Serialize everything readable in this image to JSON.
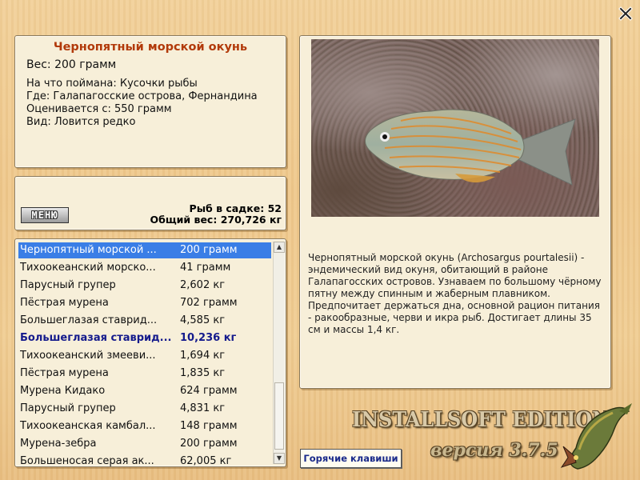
{
  "fish": {
    "name": "Чернопятный морской окунь",
    "weight_line": "Вес: 200 грамм",
    "info_lines": [
      "На что поймана: Кусочки рыбы",
      "Где: Галапагосские острова, Фернандина",
      "Оценивается с: 550 грамм",
      "Вид: Ловится редко"
    ],
    "photo_icon": "fish-photo",
    "description": "Чернопятный морской окунь (Archosargus pourtalesii) - эндемический вид окуня, обитающий в районе Галапагосских островов. Узнаваем по большому чёрному пятну между спинным и жаберным плавником. Предпочитает держаться дна, основной рацион питания - ракообразные, черви и икра рыб. Достигает длины 35 см и массы 1,4 кг."
  },
  "stats": {
    "menu_label": "МЕНЮ",
    "fish_count": "Рыб в садке: 52",
    "total_weight": "Общий вес: 270,726 кг"
  },
  "catch_list": [
    {
      "name": "Чернопятный морской ...",
      "weight": "200 грамм",
      "selected": true
    },
    {
      "name": "Тихоокеанский морско...",
      "weight": "41 грамм"
    },
    {
      "name": "Парусный групер",
      "weight": "2,602 кг"
    },
    {
      "name": "Пёстрая мурена",
      "weight": "702 грамм"
    },
    {
      "name": "Большеглазая ставрид...",
      "weight": "4,585 кг"
    },
    {
      "name": "Большеглазая ставрид...",
      "weight": "10,236 кг",
      "bold": true
    },
    {
      "name": "Тихоокеанский змееви...",
      "weight": "1,694 кг"
    },
    {
      "name": "Пёстрая мурена",
      "weight": "1,835 кг"
    },
    {
      "name": "Мурена Кидако",
      "weight": "624 грамм"
    },
    {
      "name": "Парусный групер",
      "weight": "4,831 кг"
    },
    {
      "name": "Тихоокеанская камбал...",
      "weight": "148 грамм"
    },
    {
      "name": "Мурена-зебра",
      "weight": "200 грамм"
    },
    {
      "name": "Большеносая серая ак...",
      "weight": "62,005 кг"
    }
  ],
  "footer": {
    "hotkeys_label": "Горячие клавиши",
    "brand": "INSTALLSOFT EDITION",
    "version": "версия 3.7.5"
  },
  "icons": {
    "close": "close-icon",
    "logo": "pike-logo-icon"
  },
  "colors": {
    "title": "#b23a0a",
    "selection": "#3a7ee6",
    "bold_row": "#141a8c"
  }
}
